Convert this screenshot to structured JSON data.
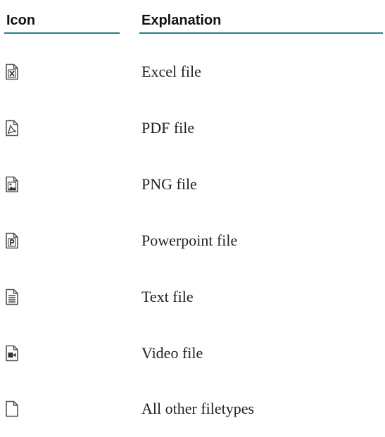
{
  "table": {
    "headers": {
      "icon": "Icon",
      "explanation": "Explanation"
    },
    "rows": [
      {
        "icon": "excel-file-icon",
        "label": "Excel file"
      },
      {
        "icon": "pdf-file-icon",
        "label": "PDF file"
      },
      {
        "icon": "png-file-icon",
        "label": "PNG file"
      },
      {
        "icon": "powerpoint-file-icon",
        "label": "Powerpoint file"
      },
      {
        "icon": "text-file-icon",
        "label": "Text file"
      },
      {
        "icon": "video-file-icon",
        "label": "Video file"
      },
      {
        "icon": "generic-file-icon",
        "label": "All other filetypes"
      }
    ]
  },
  "colors": {
    "header_rule": "#2f7a87",
    "icon_stroke": "#555555",
    "text": "#222222"
  }
}
